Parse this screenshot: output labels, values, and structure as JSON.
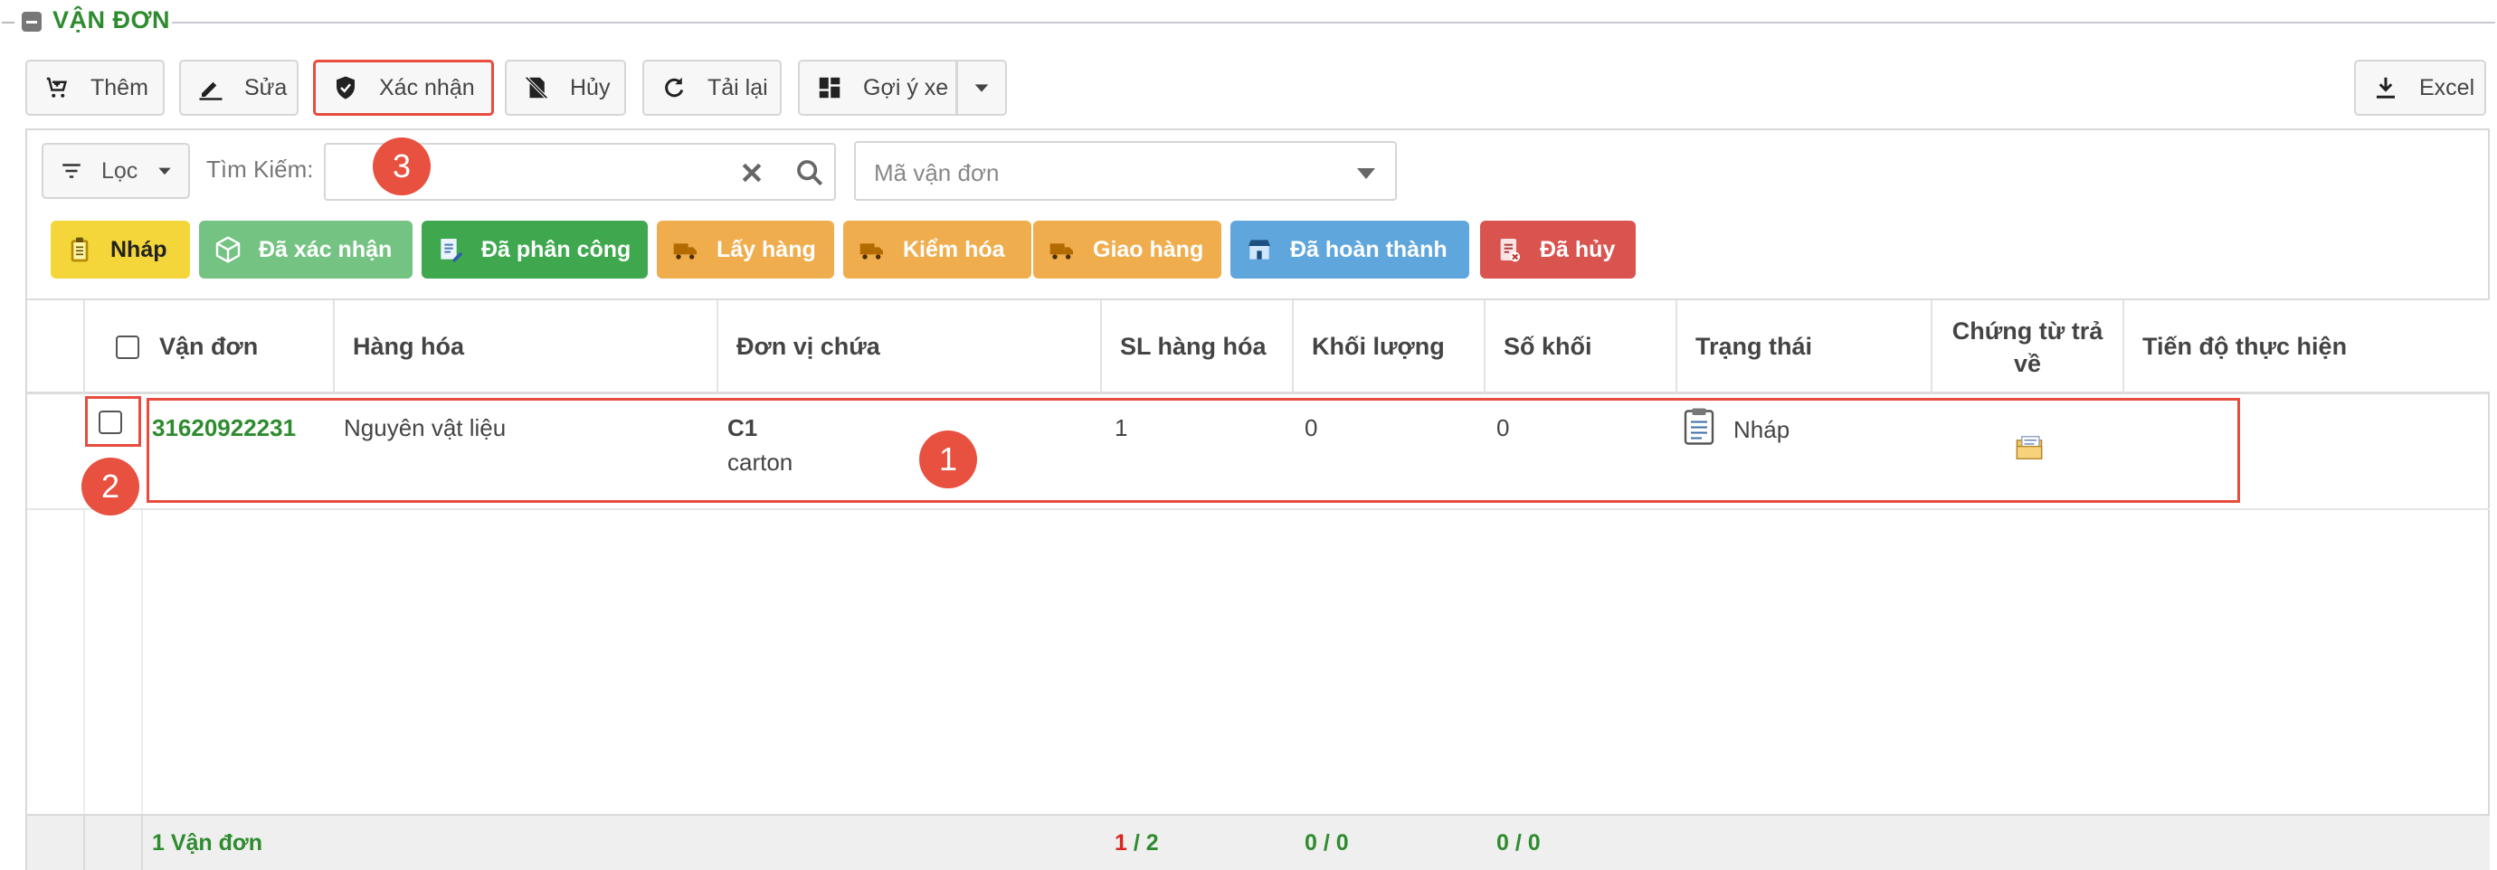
{
  "section": {
    "title": "VẬN ĐƠN"
  },
  "toolbar": {
    "add": "Thêm",
    "edit": "Sửa",
    "confirm": "Xác nhận",
    "cancel": "Hủy",
    "reload": "Tải lại",
    "suggest_vehicle": "Gợi ý xe",
    "excel": "Excel"
  },
  "filter": {
    "button": "Lọc",
    "search_label": "Tìm Kiếm:",
    "search_value": "",
    "select_placeholder": "Mã vận đơn"
  },
  "status_chips": [
    "Nháp",
    "Đã xác nhận",
    "Đã phân công",
    "Lấy hàng",
    "Kiểm hóa",
    "Giao hàng",
    "Đã hoàn thành",
    "Đã hủy"
  ],
  "table": {
    "columns": [
      "Vận đơn",
      "Hàng hóa",
      "Đơn vị chứa",
      "SL hàng hóa",
      "Khối lượng",
      "Số khối",
      "Trạng thái",
      "Chứng từ trả",
      "về",
      "Tiến độ thực hiện"
    ],
    "rows": [
      {
        "code": "31620922231",
        "goods": "Nguyên vật liệu",
        "unit_code": "C1",
        "unit_type": "carton",
        "qty": "1",
        "weight": "0",
        "volume": "0",
        "status": "Nháp"
      }
    ],
    "footer": {
      "count": "1 Vận đơn",
      "qty_a": "1",
      "qty_b": " / 2",
      "weight": "0 / 0",
      "volume": "0 / 0"
    }
  },
  "annotations": [
    "1",
    "2",
    "3"
  ],
  "colors": {
    "accent_green": "#2e8b2e",
    "highlight_red": "#e74c3c",
    "chip_draft": "#f4d63a",
    "chip_confirmed": "#74c383",
    "chip_assigned": "#3fa84f",
    "chip_orange": "#f0ad4e",
    "chip_done": "#5fa6dc",
    "chip_cancelled": "#d9534f"
  }
}
